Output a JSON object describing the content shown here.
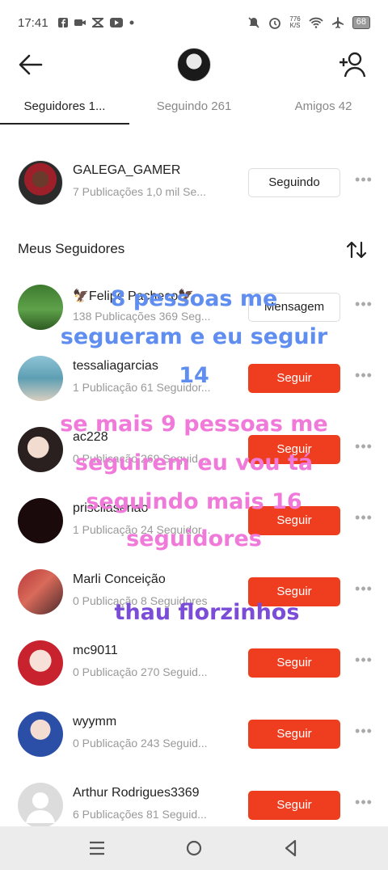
{
  "status_bar": {
    "time": "17:41",
    "net_speed_value": "776",
    "net_speed_unit": "K/S",
    "battery": "68",
    "icons": [
      "facebook-icon",
      "video-icon",
      "capcut-icon",
      "youtube-icon",
      "dot-icon",
      "mute-icon",
      "alarm-icon",
      "wifi-icon",
      "airplane-icon"
    ]
  },
  "header": {
    "back_icon": "arrow-left-icon",
    "add_user_icon": "add-user-icon"
  },
  "tabs": [
    {
      "label": "Seguidores 1..."
    },
    {
      "label": "Seguindo 261"
    },
    {
      "label": "Amigos 42"
    }
  ],
  "featured_user": {
    "name": "GALEGA_GAMER",
    "meta": "7 Publicações   1,0 mil Se...",
    "button": "Seguindo"
  },
  "section": {
    "title": "Meus Seguidores",
    "sort_icon": "sort-arrows-icon"
  },
  "followers": [
    {
      "name": "🦅Felipe Pacheco🦅",
      "meta": "138 Publicações   369 Seg...",
      "button": "Mensagem",
      "style": "outline"
    },
    {
      "name": "tessaliagarcias",
      "meta": "1 Publicação   61 Seguidor...",
      "button": "Seguir",
      "style": "red"
    },
    {
      "name": "ac228",
      "meta": "0 Publicação   269 Seguid...",
      "button": "Seguir",
      "style": "red"
    },
    {
      "name": "priscilasenao",
      "meta": "1 Publicação   24 Seguidor...",
      "button": "Seguir",
      "style": "red"
    },
    {
      "name": "Marli Conceição",
      "meta": "0 Publicação   8 Seguidores",
      "button": "Seguir",
      "style": "red"
    },
    {
      "name": "mc9011",
      "meta": "0 Publicação   270 Seguid...",
      "button": "Seguir",
      "style": "red"
    },
    {
      "name": "wyymm",
      "meta": "0 Publicação   243 Seguid...",
      "button": "Seguir",
      "style": "red"
    },
    {
      "name": "Arthur Rodrigues3369",
      "meta": "6 Publicações   81 Seguid...",
      "button": "Seguir",
      "style": "red"
    }
  ],
  "overlay_text": {
    "line1": "8 pessoas me",
    "line2": "segueram e eu seguir",
    "line3": "14",
    "line4": "se mais 9 pessoas me",
    "line5": "seguirem eu vou tá",
    "line6": "seguindo mais 16",
    "line7": "seguidores",
    "line8": "thau florzinhos"
  },
  "nav_bar": {
    "icons": [
      "menu-icon",
      "home-circle-icon",
      "back-triangle-icon"
    ]
  }
}
